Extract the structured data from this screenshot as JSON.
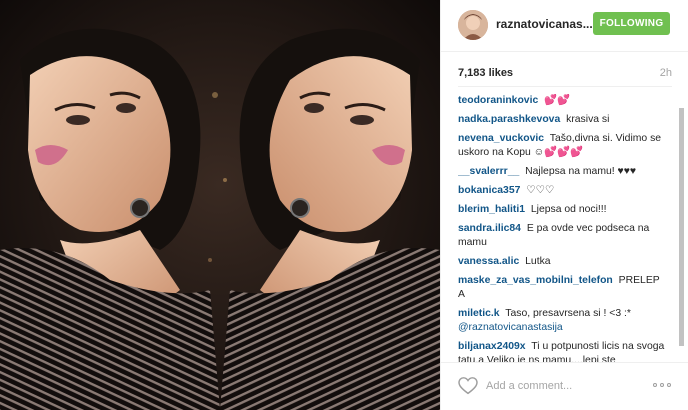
{
  "post": {
    "username": "raznatovicanas...",
    "follow_label": "FOLLOWING",
    "likes": "7,183 likes",
    "time_ago": "2h",
    "add_comment_placeholder": "Add a comment..."
  },
  "colors": {
    "username": "#262626",
    "comment_author": "#125688",
    "follow_button": "#70c050",
    "muted_text": "#a5a5a5"
  },
  "icons": {
    "like": "heart-outline-icon",
    "more": "more-options-icon"
  },
  "comments": [
    {
      "author": "teodoraninkovic",
      "text": "💕💕"
    },
    {
      "author": "nadka.parashkevova",
      "text": "krasiva si"
    },
    {
      "author": "nevena_vuckovic",
      "text": "Tašo,divna si. Vidimo se uskoro na Kopu ☺💕💕💕"
    },
    {
      "author": "__svalerrr__",
      "text": "Najlepsa na mamu! ♥♥♥"
    },
    {
      "author": "bokanica357",
      "text": "♡♡♡"
    },
    {
      "author": "blerim_haliti1",
      "text": "Ljepsa od noci!!!"
    },
    {
      "author": "sandra.ilic84",
      "text": "E pa ovde vec podseca na mamu"
    },
    {
      "author": "vanessa.alic",
      "text": "Lutka"
    },
    {
      "author": "maske_za_vas_mobilni_telefon",
      "text": "PRELEP A"
    },
    {
      "author": "miletic.k",
      "text": "Taso, presavrsena si ! <3 :*",
      "mention": "@raznatovicanastasija"
    },
    {
      "author": "biljanax2409x",
      "text": "Ti u potpunosti licis na svoga tatu,a Veljko je ns mamu....lepi ste"
    }
  ]
}
